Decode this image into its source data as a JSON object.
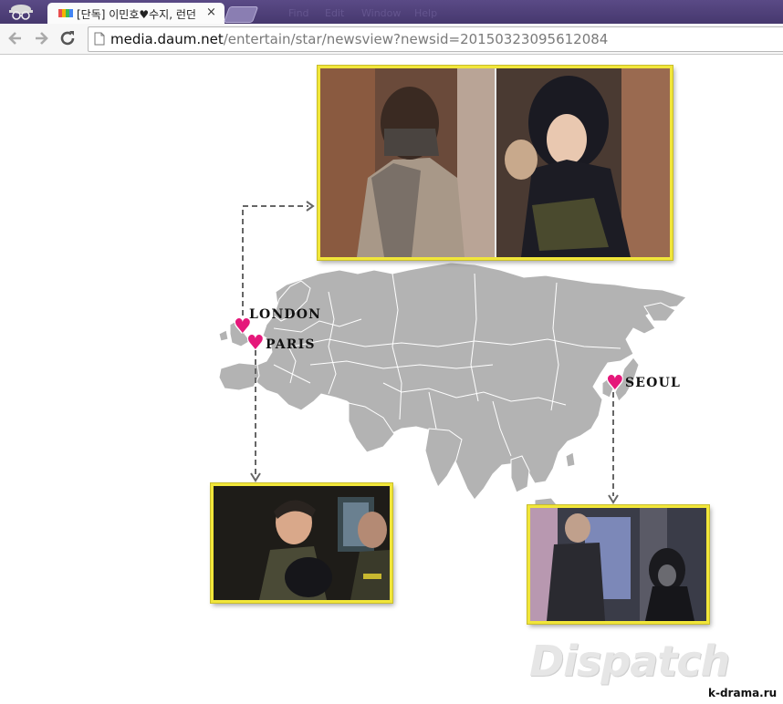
{
  "browser": {
    "tab_title": "[단독] 이민호♥수지, 런던",
    "tab_close": "×",
    "ghost_tabs": [
      "Find",
      "Edit",
      "Window",
      "Help"
    ],
    "url_host": "media.daum.net",
    "url_path": "/entertain/star/newsview?newsid=20150323095612084"
  },
  "map": {
    "cities": [
      {
        "name": "LONDON"
      },
      {
        "name": "PARIS"
      },
      {
        "name": "SEOUL"
      }
    ],
    "heart_glyph": "♥",
    "colors": {
      "land": "#b3b3b3",
      "borders": "#ffffff",
      "arrow": "#666666",
      "heart": "#e5187a",
      "frame": "#f1e63a"
    }
  },
  "photos": {
    "london": "london-photo",
    "paris": "paris-photo",
    "seoul": "seoul-photo"
  },
  "watermark": {
    "brand": "Dispatch",
    "credit": "k-drama.ru"
  }
}
